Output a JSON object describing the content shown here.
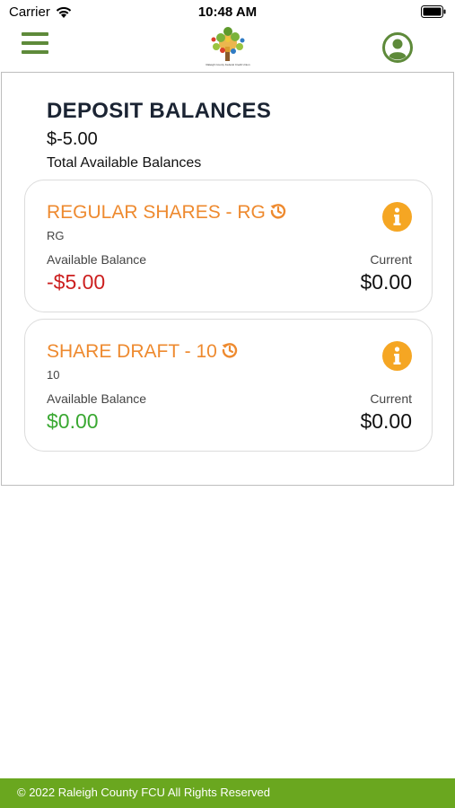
{
  "status_bar": {
    "carrier": "Carrier",
    "time": "10:48 AM",
    "icons": [
      "wifi-icon",
      "battery-icon"
    ]
  },
  "header": {
    "logo_caption": "Raleigh County Federal Credit Union",
    "icons": [
      "hamburger-menu-icon",
      "user-profile-icon"
    ],
    "menu_color": "#5e8a3a",
    "profile_color": "#5e8a3a"
  },
  "summary": {
    "title": "DEPOSIT BALANCES",
    "total_amount": "$-5.00",
    "total_label": "Total Available Balances"
  },
  "accounts": [
    {
      "name": "REGULAR SHARES - RG",
      "code": "RG",
      "available_label": "Available Balance",
      "available_value": "-$5.00",
      "current_label": "Current",
      "current_value": "$0.00",
      "available_color": "#cc1f1f"
    },
    {
      "name": "SHARE DRAFT - 10",
      "code": "10",
      "available_label": "Available Balance",
      "available_value": "$0.00",
      "current_label": "Current",
      "current_value": "$0.00",
      "available_color": "#3aa832"
    }
  ],
  "colors": {
    "accent_orange": "#ee8a2f",
    "info_icon": "#f5a623",
    "footer_green": "#6aa71f"
  },
  "footer": {
    "text": "© 2022 Raleigh County FCU All Rights Reserved"
  }
}
